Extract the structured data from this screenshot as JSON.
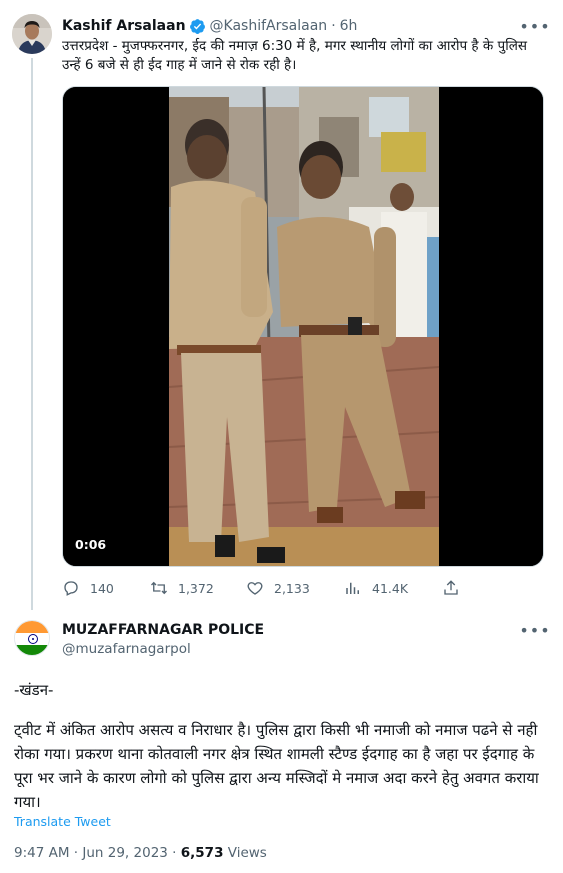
{
  "quoted_tweet": {
    "author_name": "Kashif Arsalaan",
    "handle": "@KashifArsalaan",
    "separator": "·",
    "time": "6h",
    "text": "उत्तरप्रदेश - मुजफ्फरनगर, ईद की नमाज़ 6:30 में है, मगर स्थानीय लोगों का आरोप है के पुलिस उन्हें 6 बजे से ही ईद गाह में जाने से रोक रही है।",
    "video_duration": "0:06",
    "more_icon": "more-dots-icon",
    "stats": {
      "replies": "140",
      "retweets": "1,372",
      "likes": "2,133",
      "views": "41.4K"
    }
  },
  "main_tweet": {
    "author_name": "MUZAFFARNAGAR POLICE",
    "handle": "@muzafarnagarpol",
    "heading": "-खंडन-",
    "body": "ट्वीट में अंकित आरोप असत्य व निराधार है। पुलिस द्वारा किसी भी नमाजी को नमाज पढने से नही रोका गया। प्रकरण थाना कोतवाली नगर क्षेत्र स्थित शामली स्टैण्ड ईदगाह का है जहा पर ईदगाह के पूरा भर जाने के कारण लोगो को पुलिस द्वारा अन्य मस्जिदों मे नमाज अदा करने हेतु अवगत कराया गया।",
    "translate_label": "Translate Tweet",
    "timestamp": "9:47 AM · Jun 29, 2023",
    "meta_separator": "·",
    "views_count": "6,573",
    "views_label": "Views",
    "more_icon": "more-dots-icon"
  },
  "colors": {
    "link_blue": "#1d9bf0",
    "secondary_text": "#536471",
    "primary_text": "#0f1419",
    "verified_badge": "#1d9bf0",
    "uniform_khaki": "#b89a72"
  }
}
